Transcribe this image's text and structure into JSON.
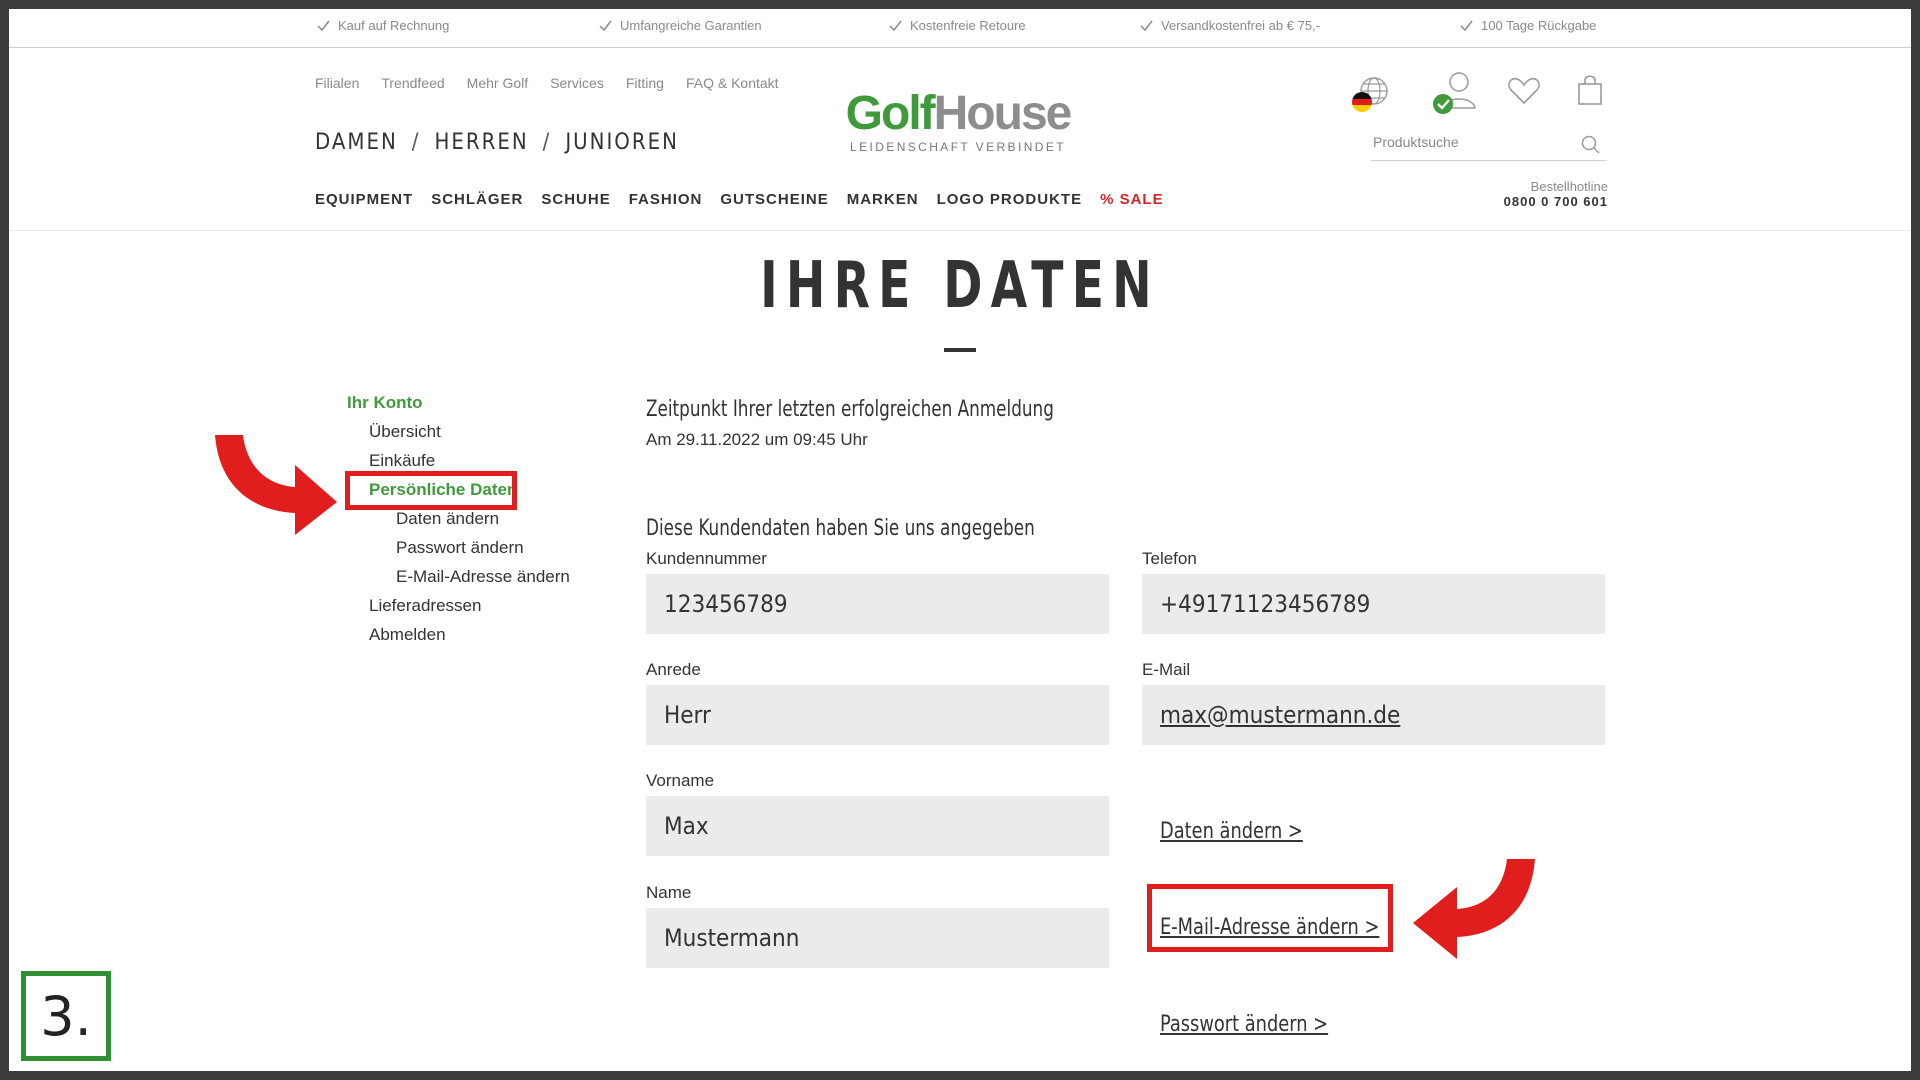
{
  "benefits": [
    "Kauf auf Rechnung",
    "Umfangreiche Garantien",
    "Kostenfreie Retoure",
    "Versandkostenfrei ab € 75,-",
    "100 Tage Rückgabe"
  ],
  "utility_nav": [
    "Filialen",
    "Trendfeed",
    "Mehr Golf",
    "Services",
    "Fitting",
    "FAQ & Kontakt"
  ],
  "gender_nav": {
    "damen": "DAMEN",
    "herren": "HERREN",
    "junioren": "JUNIOREN",
    "separator": "/"
  },
  "category_nav": [
    "EQUIPMENT",
    "SCHLÄGER",
    "SCHUHE",
    "FASHION",
    "GUTSCHEINE",
    "MARKEN",
    "LOGO PRODUKTE",
    "% SALE"
  ],
  "logo": {
    "word1": "Golf",
    "word2": "House",
    "tagline": "LEIDENSCHAFT VERBINDET"
  },
  "header_icons": [
    "globe-icon",
    "user-icon",
    "heart-icon",
    "bag-icon"
  ],
  "search": {
    "placeholder": "Produktsuche"
  },
  "hotline": {
    "label": "Bestellhotline",
    "number": "0800 0 700 601"
  },
  "page_title": "IHRE DATEN",
  "sidebar": {
    "heading": "Ihr Konto",
    "items": {
      "overview": "Übersicht",
      "purchases": "Einkäufe",
      "personal": "Persönliche Daten",
      "change_data": "Daten ändern",
      "change_password": "Passwort ändern",
      "change_email": "E-Mail-Adresse ändern",
      "addresses": "Lieferadressen",
      "logout": "Abmelden"
    }
  },
  "last_login": {
    "heading": "Zeitpunkt Ihrer letzten erfolgreichen Anmeldung",
    "value": "Am 29.11.2022 um 09:45 Uhr"
  },
  "customer_data": {
    "heading": "Diese Kundendaten haben Sie uns angegeben",
    "fields": {
      "kundennummer": {
        "label": "Kundennummer",
        "value": "123456789"
      },
      "telefon": {
        "label": "Telefon",
        "value": "+49171123456789"
      },
      "anrede": {
        "label": "Anrede",
        "value": "Herr"
      },
      "email": {
        "label": "E-Mail",
        "value": "max@mustermann.de"
      },
      "vorname": {
        "label": "Vorname",
        "value": "Max"
      },
      "name": {
        "label": "Name",
        "value": "Mustermann"
      }
    }
  },
  "actions": {
    "change_data": "Daten ändern >",
    "change_email": "E-Mail-Adresse ändern >",
    "change_password": "Passwort ändern >"
  },
  "step_badge": "3.",
  "colors": {
    "brand_green": "#3f9a3c",
    "sale_red": "#d6232b",
    "annotation_red": "#e01e1e",
    "field_bg": "#eceaea"
  }
}
